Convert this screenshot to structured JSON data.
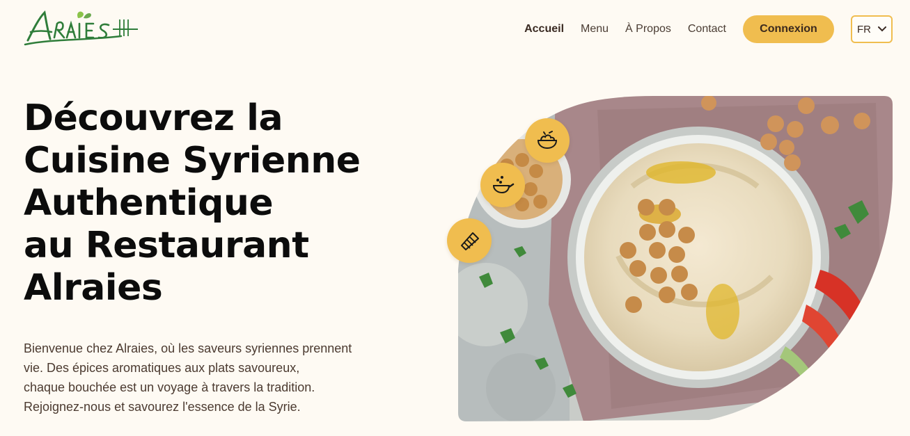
{
  "brand": {
    "name": "Alraies"
  },
  "nav": {
    "links": [
      {
        "label": "Accueil",
        "active": true
      },
      {
        "label": "Menu"
      },
      {
        "label": "À Propos"
      },
      {
        "label": "Contact"
      }
    ],
    "login_label": "Connexion",
    "language": "FR"
  },
  "hero": {
    "headline_lines": [
      "Découvrez la",
      "Cuisine Syrienne",
      "Authentique",
      "au Restaurant",
      "Alraies"
    ],
    "intro_lines": [
      "Bienvenue chez Alraies, où les saveurs syriennes prennent",
      "vie. Des épices aromatiques aux plats savoureux,",
      "chaque bouchée est un voyage à travers la tradition.",
      "Rejoignez-nous et savourez l'essence de la Syrie."
    ],
    "badges": [
      "salad-bowl-icon",
      "cooking-pan-icon",
      "wrap-sandwich-icon"
    ]
  },
  "colors": {
    "accent": "#f0bd4f",
    "background": "#fefaf3",
    "logo_green": "#2e7d32",
    "text_brown": "#4b3a30"
  }
}
